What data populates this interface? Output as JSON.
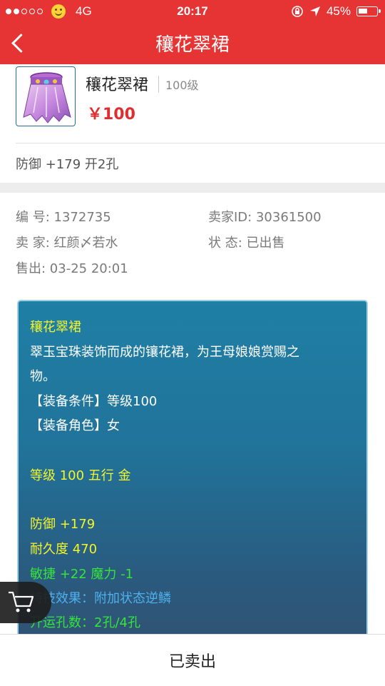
{
  "status_bar": {
    "carrier": "4G",
    "time": "20:17",
    "battery": "45%",
    "icons": [
      "signal-dots-icon",
      "smiley-emoji-icon",
      "rotation-lock-icon",
      "location-arrow-icon",
      "battery-icon"
    ]
  },
  "nav": {
    "title": "穰花翠裙",
    "back_icon": "chevron-left-icon"
  },
  "item": {
    "name": "穰花翠裙",
    "level": "100级",
    "price": "￥100",
    "brief": "防御 +179 开2孔"
  },
  "details": {
    "id_label": "编  号: ",
    "id_value": "1372735",
    "seller_id_label": "卖家ID: ",
    "seller_id_value": "30361500",
    "seller_label": "卖  家: ",
    "seller_value": "红颜〆若水",
    "status_label": "状  态: ",
    "status_value": "已出售",
    "sold_label": "售出: ",
    "sold_value": "03-25 20:01"
  },
  "description": {
    "name": "穰花翠裙",
    "text_line1": "翠玉宝珠装饰而成的镶花裙，为王母娘娘赏赐之",
    "text_line2": "物。",
    "req_level": "【装备条件】等级100",
    "req_role": "【装备角色】女",
    "grade": "等级 100  五行 金",
    "defense": "防御 +179",
    "durability": "耐久度 470",
    "bonus": "敏捷 +22 魔力 -1",
    "special": "特技效果：附加状态逆鳞",
    "holes": "开运孔数：2孔/4孔"
  },
  "cart": {
    "icon": "shopping-cart-icon"
  },
  "bottom": {
    "status": "已卖出"
  },
  "colors": {
    "brand_red": "#e63434",
    "price_red": "#e02d2d",
    "desc_yellow": "#f4f42b",
    "desc_green": "#35e43c",
    "desc_blue": "#4fb0ee"
  }
}
